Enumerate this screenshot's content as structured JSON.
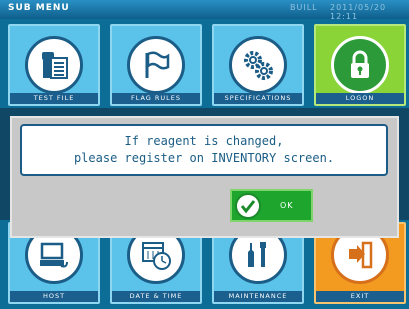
{
  "header": {
    "title": "SUB MENU",
    "status_mode": "BUILL",
    "datetime": "2011/05/20 12:11"
  },
  "tiles_top": [
    {
      "label": "TEST FILE",
      "icon": "test-file-icon"
    },
    {
      "label": "FLAG RULES",
      "icon": "flag-icon"
    },
    {
      "label": "SPECIFICATIONS",
      "icon": "gears-icon"
    },
    {
      "label": "LOGON",
      "icon": "lock-icon"
    }
  ],
  "tiles_bottom": [
    {
      "label": "HOST",
      "icon": "host-computer-icon"
    },
    {
      "label": "DATE & TIME",
      "icon": "calendar-clock-icon"
    },
    {
      "label": "MAINTENANCE",
      "icon": "tools-icon"
    },
    {
      "label": "EXIT",
      "icon": "exit-door-icon"
    }
  ],
  "dialog": {
    "message_line1": "If reagent is changed,",
    "message_line2": "please register on INVENTORY screen.",
    "ok_label": "OK"
  },
  "colors": {
    "background": "#0c6d97",
    "tile_blue": "#5bc2ea",
    "tile_green": "#8bd437",
    "tile_orange": "#f39a21",
    "ok_green": "#1da52d",
    "text_blue": "#1b5d86"
  }
}
